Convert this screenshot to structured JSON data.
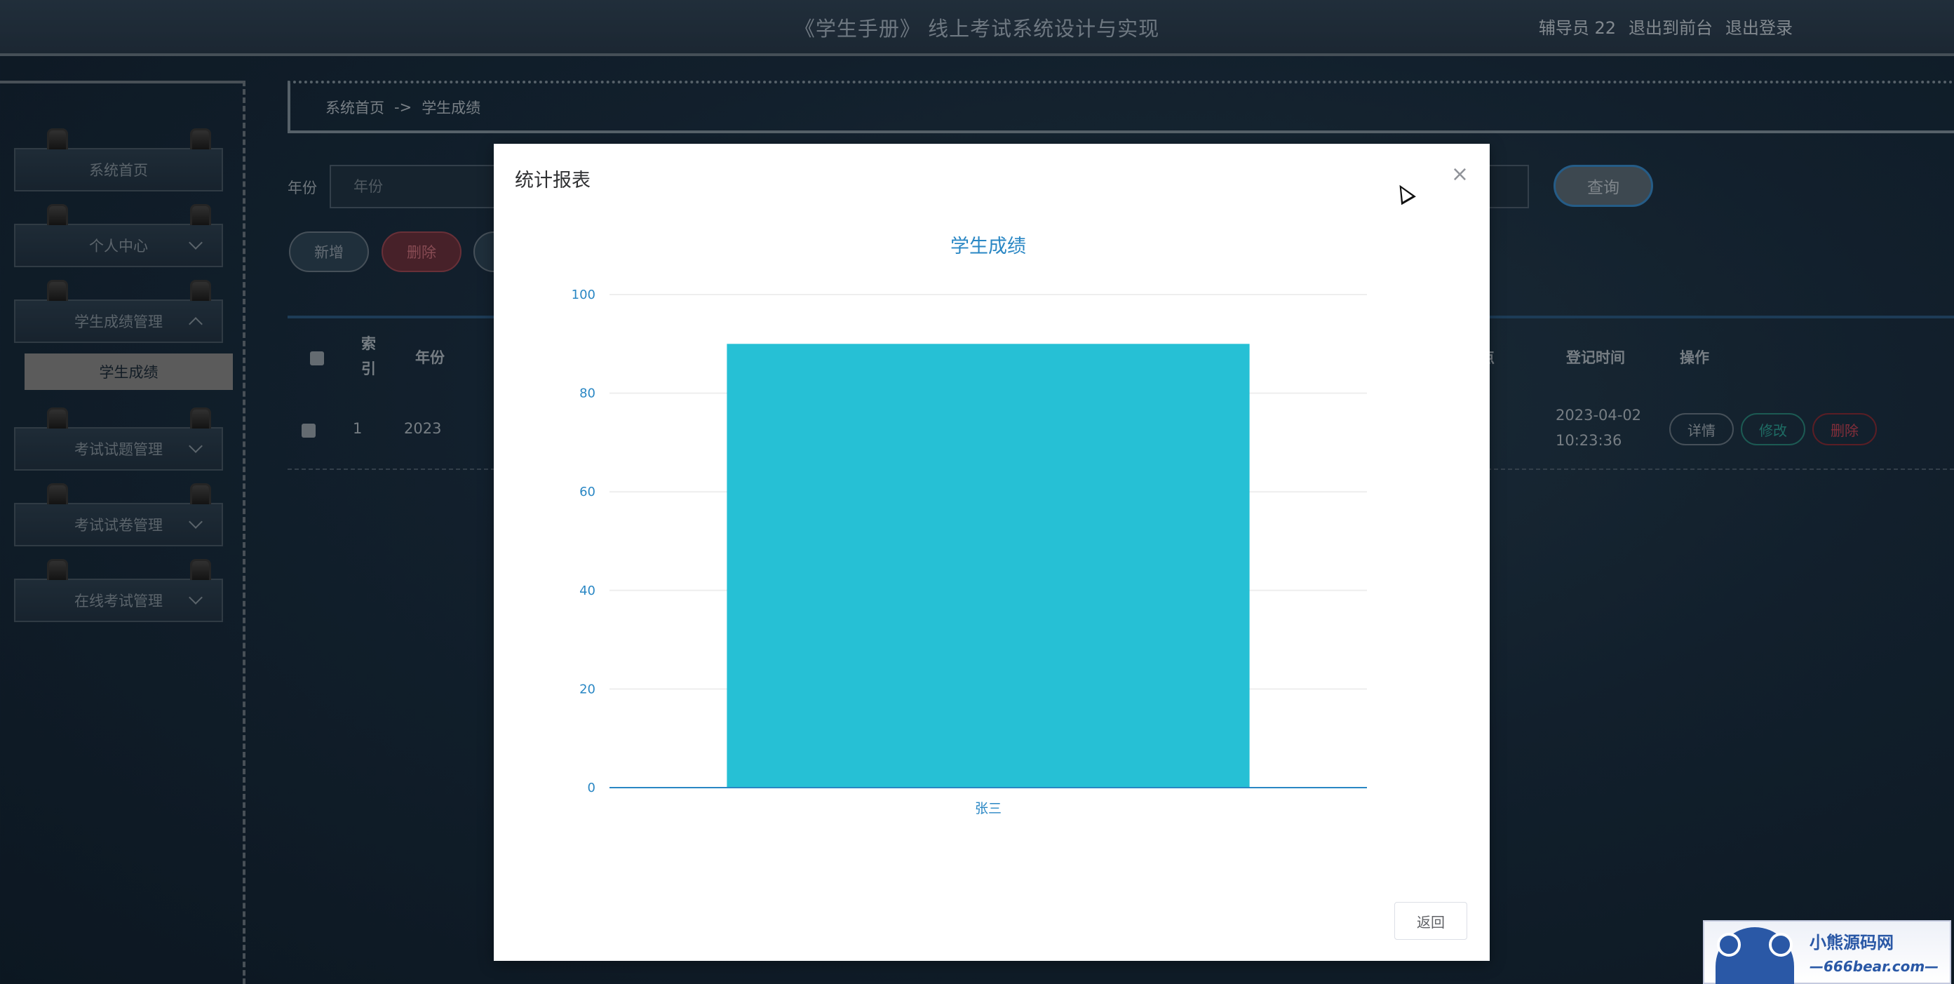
{
  "header": {
    "title": "《学生手册》 线上考试系统设计与实现",
    "user": "辅导员 22",
    "to_front": "退出到前台",
    "logout": "退出登录"
  },
  "sidebar": {
    "items": [
      {
        "label": "系统首页"
      },
      {
        "label": "个人中心"
      },
      {
        "label": "学生成绩管理"
      },
      {
        "label": "考试试题管理"
      },
      {
        "label": "考试试卷管理"
      },
      {
        "label": "在线考试管理"
      }
    ],
    "active_sub": "学生成绩"
  },
  "breadcrumb": {
    "home": "系统首页",
    "sep": "->",
    "current": "学生成绩"
  },
  "search": {
    "label": "年份",
    "placeholder": "年份",
    "query_btn": "查询"
  },
  "actions": {
    "add": "新增",
    "delete": "删除"
  },
  "table": {
    "headers": {
      "index": "索引",
      "year": "年份",
      "partial": "点",
      "reg_time": "登记时间",
      "ops": "操作"
    },
    "rows": [
      {
        "index": "1",
        "year": "2023",
        "reg_date": "2023-04-02",
        "reg_clock": "10:23:36"
      }
    ],
    "row_btns": {
      "detail": "详情",
      "edit": "修改",
      "delete": "删除"
    }
  },
  "modal": {
    "title": "统计报表",
    "close": "×",
    "back": "返回"
  },
  "chart_data": {
    "type": "bar",
    "title": "学生成绩",
    "categories": [
      "张三"
    ],
    "values": [
      90
    ],
    "ylim": [
      0,
      100
    ],
    "yticks": [
      0,
      20,
      40,
      60,
      80,
      100
    ],
    "grid": true,
    "bar_color": "#26c0d5",
    "title_color": "#2a87c4",
    "axis_color": "#2a87c4"
  },
  "watermark": {
    "line1": "小熊源码网",
    "line2": "—666bear.com—"
  }
}
